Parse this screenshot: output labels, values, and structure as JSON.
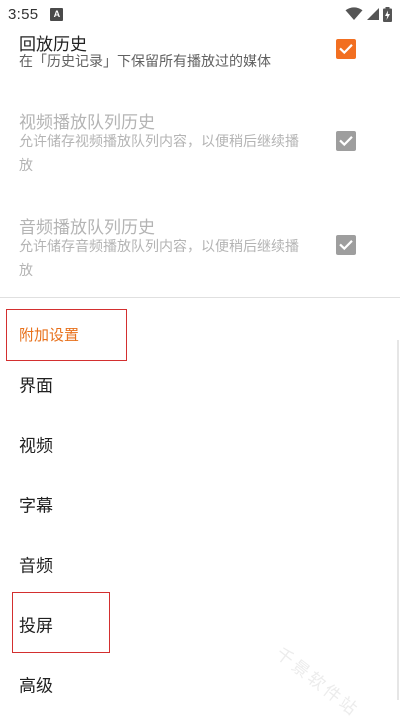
{
  "status_bar": {
    "time": "3:55",
    "app_icon_letter": "A",
    "icons": [
      "wifi-icon",
      "signal-icon",
      "battery-charging-icon"
    ]
  },
  "colors": {
    "accent": "#f26f21",
    "category": "#e8711c",
    "highlight": "#d32f2f",
    "disabled": "#b4b4b4"
  },
  "history_settings": [
    {
      "title": "回放历史",
      "summary": "在「历史记录」下保留所有播放过的媒体",
      "checked": true,
      "enabled": true
    },
    {
      "title": "视频播放队列历史",
      "summary": "允许储存视频播放队列内容，以便稍后继续播放",
      "checked": true,
      "enabled": false
    },
    {
      "title": "音频播放队列历史",
      "summary": "允许储存音频播放队列内容，以便稍后继续播放",
      "checked": true,
      "enabled": false
    }
  ],
  "extra_settings": {
    "title": "附加设置",
    "items": [
      {
        "label": "界面"
      },
      {
        "label": "视频"
      },
      {
        "label": "字幕"
      },
      {
        "label": "音频"
      },
      {
        "label": "投屏"
      },
      {
        "label": "高级"
      }
    ]
  },
  "watermark": "千景软件站"
}
